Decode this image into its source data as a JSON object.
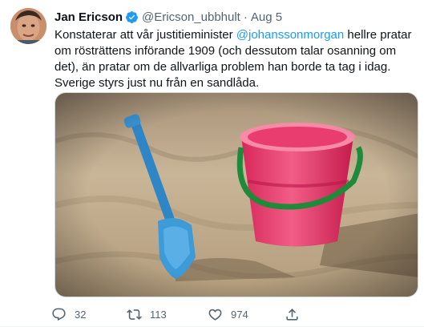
{
  "author": {
    "name": "Jan Ericson",
    "handle": "@Ericson_ubbhult",
    "date": "Aug 5"
  },
  "tweet": {
    "text_before": "Konstaterar att vår justitieminister ",
    "mention": "@johanssonmorgan",
    "text_after": " hellre pratar om rösträttens införande 1909 (och dessutom talar osanning om det), än pratar om de allvarliga problem han borde ta tag i idag. Sverige styrs just nu från en  sandlåda."
  },
  "stats": {
    "replies": "32",
    "retweets": "113",
    "likes": "974"
  },
  "icons": {
    "verified": "verified-badge-icon",
    "reply": "reply-icon",
    "retweet": "retweet-icon",
    "like": "heart-icon",
    "share": "share-icon"
  },
  "colors": {
    "accent": "#1d9bf0",
    "text": "#0f1419",
    "muted": "#536471"
  }
}
